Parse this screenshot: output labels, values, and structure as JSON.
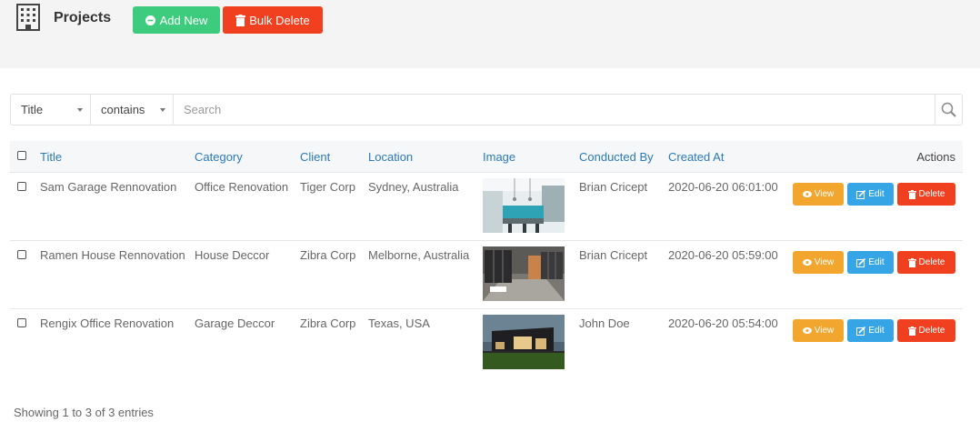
{
  "header": {
    "title": "Projects",
    "add_new_label": "Add New",
    "bulk_delete_label": "Bulk Delete"
  },
  "search": {
    "field_value": "Title",
    "operator_value": "contains",
    "placeholder": "Search"
  },
  "table": {
    "columns": [
      "Title",
      "Category",
      "Client",
      "Location",
      "Image",
      "Conducted By",
      "Created At",
      "Actions"
    ],
    "rows": [
      {
        "title": "Sam Garage Rennovation",
        "category": "Office Renovation",
        "client": "Tiger Corp",
        "location": "Sydney, Australia",
        "conducted_by": "Brian Cricept",
        "created_at": "2020-06-20 06:01:00"
      },
      {
        "title": "Ramen House Rennovation",
        "category": "House Deccor",
        "client": "Zibra Corp",
        "location": "Melborne, Australia",
        "conducted_by": "Brian Cricept",
        "created_at": "2020-06-20 05:59:00"
      },
      {
        "title": "Rengix Office Renovation",
        "category": "Garage Deccor",
        "client": "Zibra Corp",
        "location": "Texas, USA",
        "conducted_by": "John Doe",
        "created_at": "2020-06-20 05:54:00"
      }
    ],
    "actions": {
      "view": "View",
      "edit": "Edit",
      "delete": "Delete"
    }
  },
  "footer": {
    "info": "Showing 1 to 3 of 3 entries"
  },
  "colors": {
    "add_new": "#3dcc7d",
    "delete": "#f0401f",
    "view": "#f2a62d",
    "edit": "#36a5e6",
    "link": "#2a7ab8"
  },
  "icons": [
    "building-icon",
    "plus-circle-icon",
    "trash-icon",
    "search-icon",
    "eye-icon",
    "edit-icon"
  ]
}
